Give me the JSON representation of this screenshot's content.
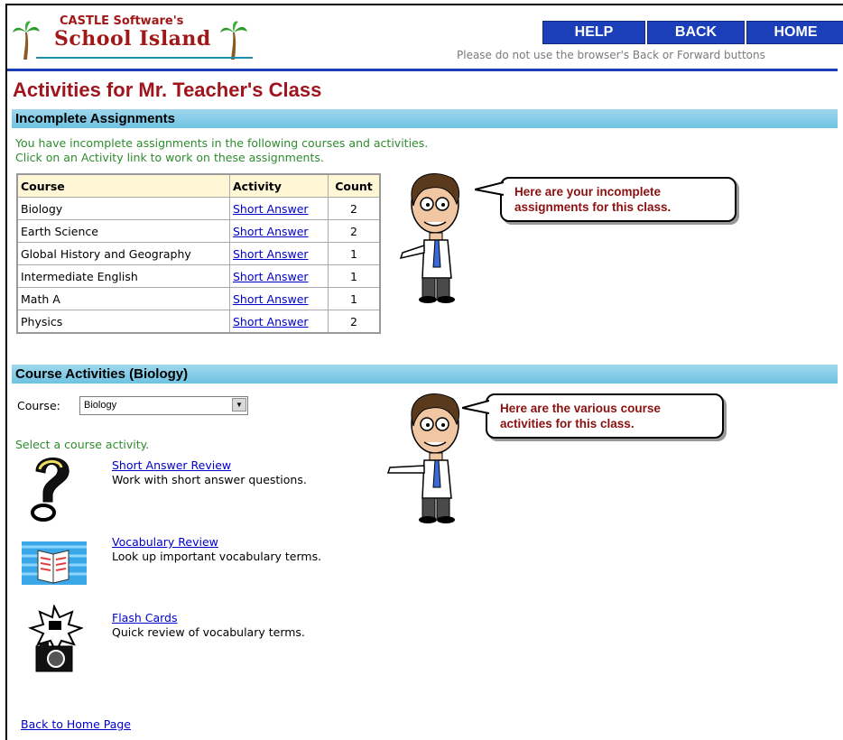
{
  "header": {
    "logo_small": "CASTLE Software's",
    "logo_big": "School Island",
    "nav": [
      {
        "label": "HELP"
      },
      {
        "label": "BACK"
      },
      {
        "label": "HOME"
      }
    ],
    "notice": "Please do not use the browser's Back or Forward buttons"
  },
  "page_title": "Activities for Mr. Teacher's Class",
  "incomplete": {
    "heading": "Incomplete Assignments",
    "intro_line1": "You have incomplete assignments in the following courses and activities.",
    "intro_line2": "Click on an Activity link to work on these assignments.",
    "columns": [
      "Course",
      "Activity",
      "Count"
    ],
    "rows": [
      {
        "course": "Biology",
        "activity": "Short Answer",
        "count": "2"
      },
      {
        "course": "Earth Science",
        "activity": "Short Answer",
        "count": "2"
      },
      {
        "course": "Global History and Geography",
        "activity": "Short Answer",
        "count": "1"
      },
      {
        "course": "Intermediate English",
        "activity": "Short Answer",
        "count": "1"
      },
      {
        "course": "Math A",
        "activity": "Short Answer",
        "count": "1"
      },
      {
        "course": "Physics",
        "activity": "Short Answer",
        "count": "2"
      }
    ],
    "bubble_line1": "Here are your incomplete",
    "bubble_line2": "assignments for this class."
  },
  "course_activities": {
    "heading": "Course Activities (Biology)",
    "course_label": "Course:",
    "course_selected": "Biology",
    "prompt": "Select a course activity.",
    "bubble_line1": "Here are the various course",
    "bubble_line2": "activities for this class.",
    "activities": [
      {
        "title": "Short Answer Review",
        "desc": "Work with short answer questions.",
        "icon": "question-mark-icon"
      },
      {
        "title": "Vocabulary Review",
        "desc": "Look up important vocabulary terms.",
        "icon": "open-book-icon"
      },
      {
        "title": "Flash Cards",
        "desc": "Quick review of vocabulary terms.",
        "icon": "camera-flash-icon"
      }
    ]
  },
  "back_link": "Back to Home Page",
  "colors": {
    "title_red": "#a0141e",
    "nav_blue": "#1a3fb8",
    "section_bar": "#6ec3e3",
    "green_text": "#2e8b2e",
    "link": "#0000cc"
  }
}
